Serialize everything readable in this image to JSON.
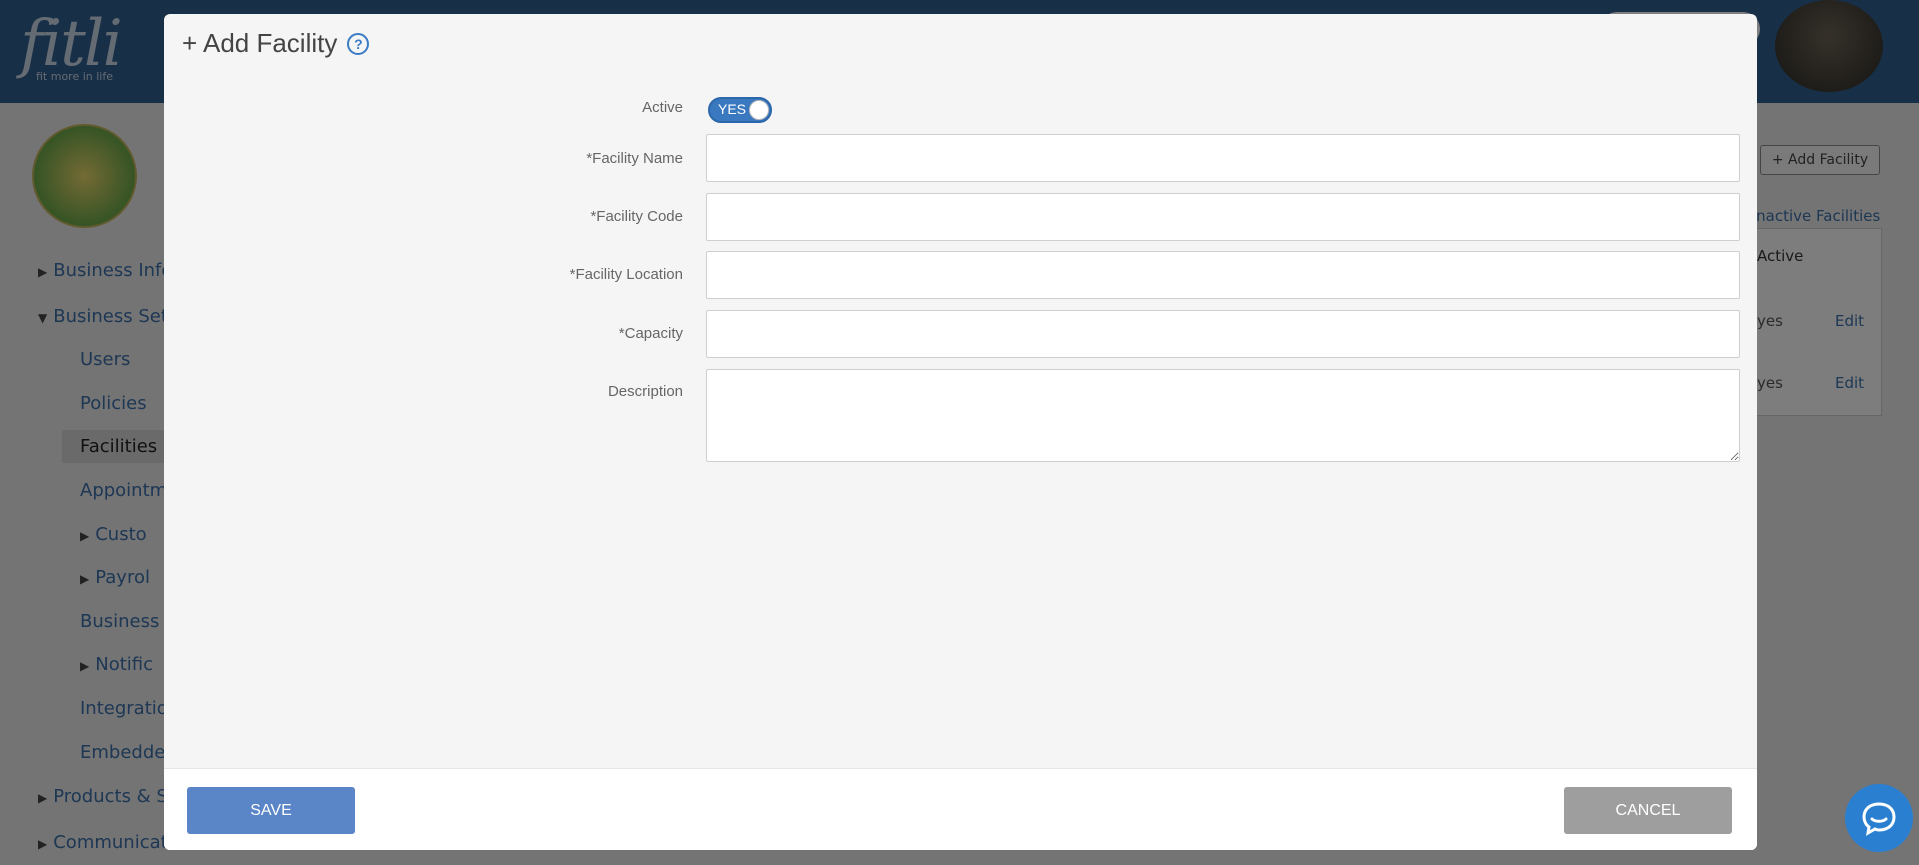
{
  "background": {
    "logo_text": "fitli",
    "logo_tagline": "fit more in life",
    "sidebar": {
      "items": [
        {
          "label": "Business Infor",
          "caret": "▶"
        },
        {
          "label": "Business Setu",
          "caret": "▼"
        },
        {
          "label": "Users",
          "caret": ""
        },
        {
          "label": "Policies",
          "caret": ""
        },
        {
          "label": "Facilities",
          "caret": ""
        },
        {
          "label": "Appointme",
          "caret": ""
        },
        {
          "label": "Custo",
          "caret": "▶"
        },
        {
          "label": "Payrol",
          "caret": "▶"
        },
        {
          "label": "Business T",
          "caret": ""
        },
        {
          "label": "Notific",
          "caret": "▶"
        },
        {
          "label": "Integration",
          "caret": ""
        },
        {
          "label": "Embedded",
          "caret": ""
        },
        {
          "label": "Products & Se",
          "caret": "▶"
        },
        {
          "label": "Communicati",
          "caret": "▶"
        }
      ]
    },
    "add_facility_button": "+ Add Facility",
    "inactive_link": "inactive Facilities",
    "table": {
      "header": "Active",
      "rows": [
        {
          "active": "yes",
          "action": "Edit"
        },
        {
          "active": "yes",
          "action": "Edit"
        }
      ]
    }
  },
  "modal": {
    "title": "+ Add Facility",
    "help_icon": "help-circle-icon",
    "fields": {
      "active": {
        "label": "Active",
        "toggle_text": "YES"
      },
      "facility_name": {
        "label": "*Facility Name",
        "value": ""
      },
      "facility_code": {
        "label": "*Facility Code",
        "value": ""
      },
      "facility_location": {
        "label": "*Facility Location",
        "value": ""
      },
      "capacity": {
        "label": "*Capacity",
        "value": ""
      },
      "description": {
        "label": "Description",
        "value": ""
      }
    },
    "footer": {
      "save_label": "SAVE",
      "cancel_label": "CANCEL"
    }
  },
  "chat": {
    "icon": "chat-bubble-icon"
  },
  "colors": {
    "accent": "#3a78c0",
    "save_button": "#5a85c6",
    "cancel_button": "#9e9e9e",
    "topbar": "#2f5f8f"
  }
}
